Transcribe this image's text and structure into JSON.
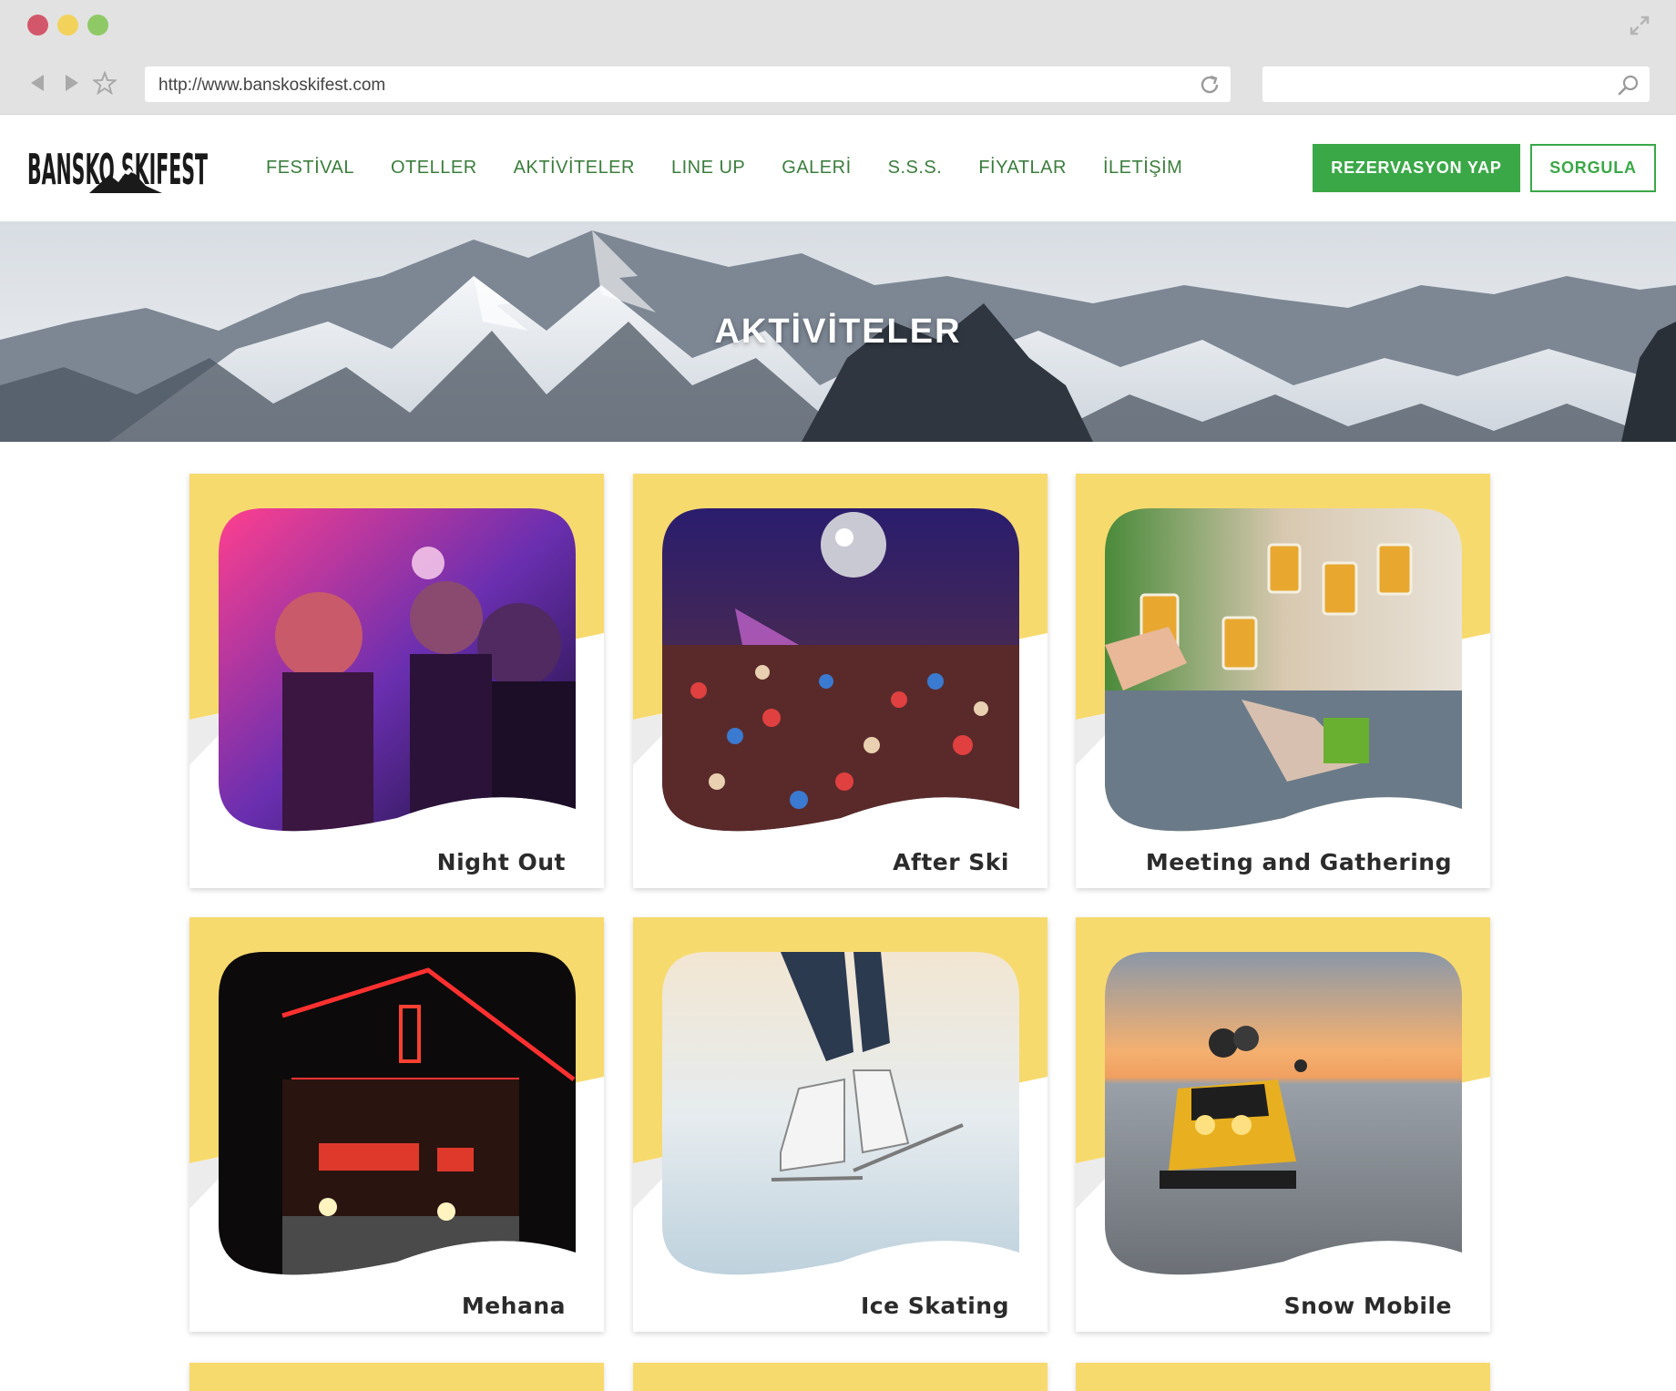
{
  "browser": {
    "url": "http://www.banskoskifest.com",
    "search_value": ""
  },
  "site": {
    "logo_text": "BANSKO SKIFEST",
    "nav": [
      "FESTİVAL",
      "OTELLER",
      "AKTİVİTELER",
      "LINE UP",
      "GALERİ",
      "S.S.S.",
      "FİYATLAR",
      "İLETİŞİM"
    ],
    "rez_button": "REZERVASYON YAP",
    "query_button": "SORGULA",
    "accent_color": "#3aa847",
    "card_color": "#f7da6e"
  },
  "hero": {
    "title": "AKTİVİTELER"
  },
  "activities": [
    {
      "label": "Night Out"
    },
    {
      "label": "After Ski"
    },
    {
      "label": "Meeting and Gathering"
    },
    {
      "label": "Mehana"
    },
    {
      "label": "Ice Skating"
    },
    {
      "label": "Snow Mobile"
    }
  ]
}
